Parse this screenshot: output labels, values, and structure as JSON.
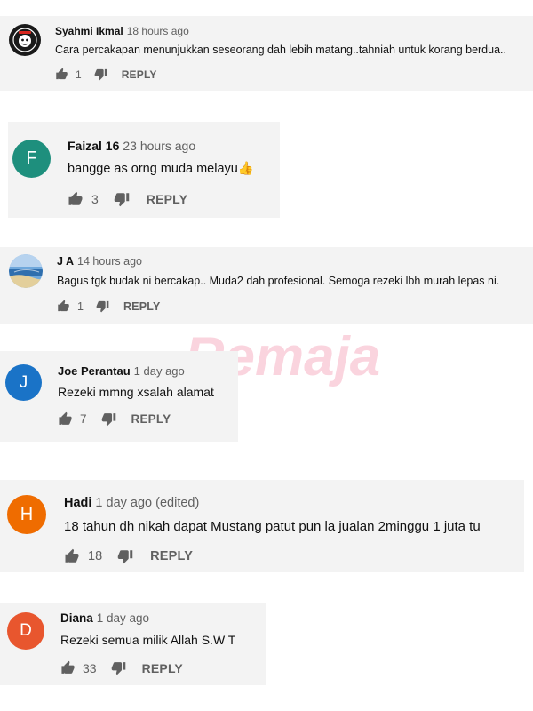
{
  "watermark": "Remaja",
  "comments": [
    {
      "author": "Syahmi Ikmal",
      "time": "18 hours ago",
      "text": "Cara percakapan menunjukkan seseorang dah lebih matang..tahniah untuk korang berdua..",
      "likes": "1",
      "reply": "REPLY",
      "avatar_type": "logo",
      "avatar_color": "#1a1a1a"
    },
    {
      "author": "Faizal 16",
      "time": "23 hours ago",
      "text": "bangge as orng muda melayu👍",
      "likes": "3",
      "reply": "REPLY",
      "avatar_type": "letter",
      "avatar_letter": "F",
      "avatar_color": "#1e8f7d"
    },
    {
      "author": "J A",
      "time": "14 hours ago",
      "text": "Bagus tgk budak ni bercakap.. Muda2 dah profesional. Semoga rezeki lbh murah lepas ni.",
      "likes": "1",
      "reply": "REPLY",
      "avatar_type": "photo",
      "avatar_color": "#3c78b4"
    },
    {
      "author": "Joe Perantau",
      "time": "1 day ago",
      "text": "Rezeki mmng xsalah alamat",
      "likes": "7",
      "reply": "REPLY",
      "avatar_type": "letter",
      "avatar_letter": "J",
      "avatar_color": "#1a73c7"
    },
    {
      "author": "Hadi",
      "time": "1 day ago (edited)",
      "text": "18 tahun dh nikah dapat Mustang patut pun la jualan 2minggu 1 juta tu",
      "likes": "18",
      "reply": "REPLY",
      "avatar_type": "letter",
      "avatar_letter": "H",
      "avatar_color": "#ef6c00"
    },
    {
      "author": "Diana",
      "time": "1 day ago",
      "text": "Rezeki semua milik Allah S.W T",
      "likes": "33",
      "reply": "REPLY",
      "avatar_type": "letter",
      "avatar_letter": "D",
      "avatar_color": "#e8562e"
    }
  ]
}
